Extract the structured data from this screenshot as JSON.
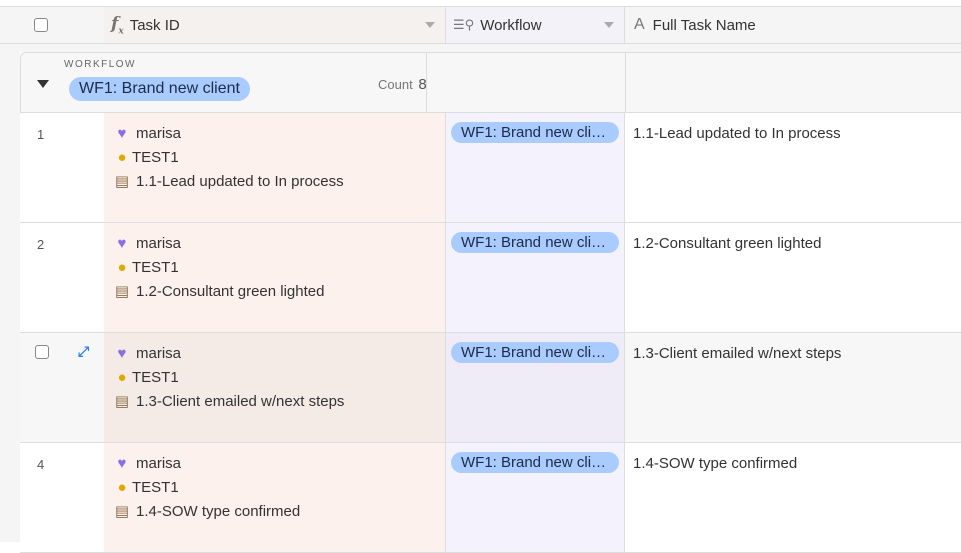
{
  "header": {
    "columns": [
      {
        "label": "Task ID",
        "icon": "formula-icon"
      },
      {
        "label": "Workflow",
        "icon": "lookup-icon"
      },
      {
        "label": "Full Task Name",
        "icon": "text-field-icon"
      }
    ]
  },
  "group": {
    "field_label": "WORKFLOW",
    "value": "WF1: Brand new client",
    "count_label": "Count",
    "count": "8"
  },
  "rows": [
    {
      "num": "1",
      "person": "marisa",
      "client": "TEST1",
      "task": "1.1-Lead updated to In process",
      "workflow": "WF1: Brand new client",
      "full_name": "1.1-Lead updated to In process"
    },
    {
      "num": "2",
      "person": "marisa",
      "client": "TEST1",
      "task": "1.2-Consultant green lighted",
      "workflow": "WF1: Brand new client",
      "full_name": "1.2-Consultant green lighted"
    },
    {
      "num": "",
      "person": "marisa",
      "client": "TEST1",
      "task": "1.3-Client emailed w/next steps",
      "workflow": "WF1: Brand new client",
      "full_name": "1.3-Client emailed w/next steps"
    },
    {
      "num": "4",
      "person": "marisa",
      "client": "TEST1",
      "task": "1.4-SOW type confirmed",
      "workflow": "WF1: Brand new client",
      "full_name": "1.4-SOW type confirmed"
    }
  ],
  "colors": {
    "pill": "#a9cbfd",
    "task_col": "#fcf1ec",
    "workflow_col": "#f4f2fd",
    "expand": "#2d7ff9"
  }
}
